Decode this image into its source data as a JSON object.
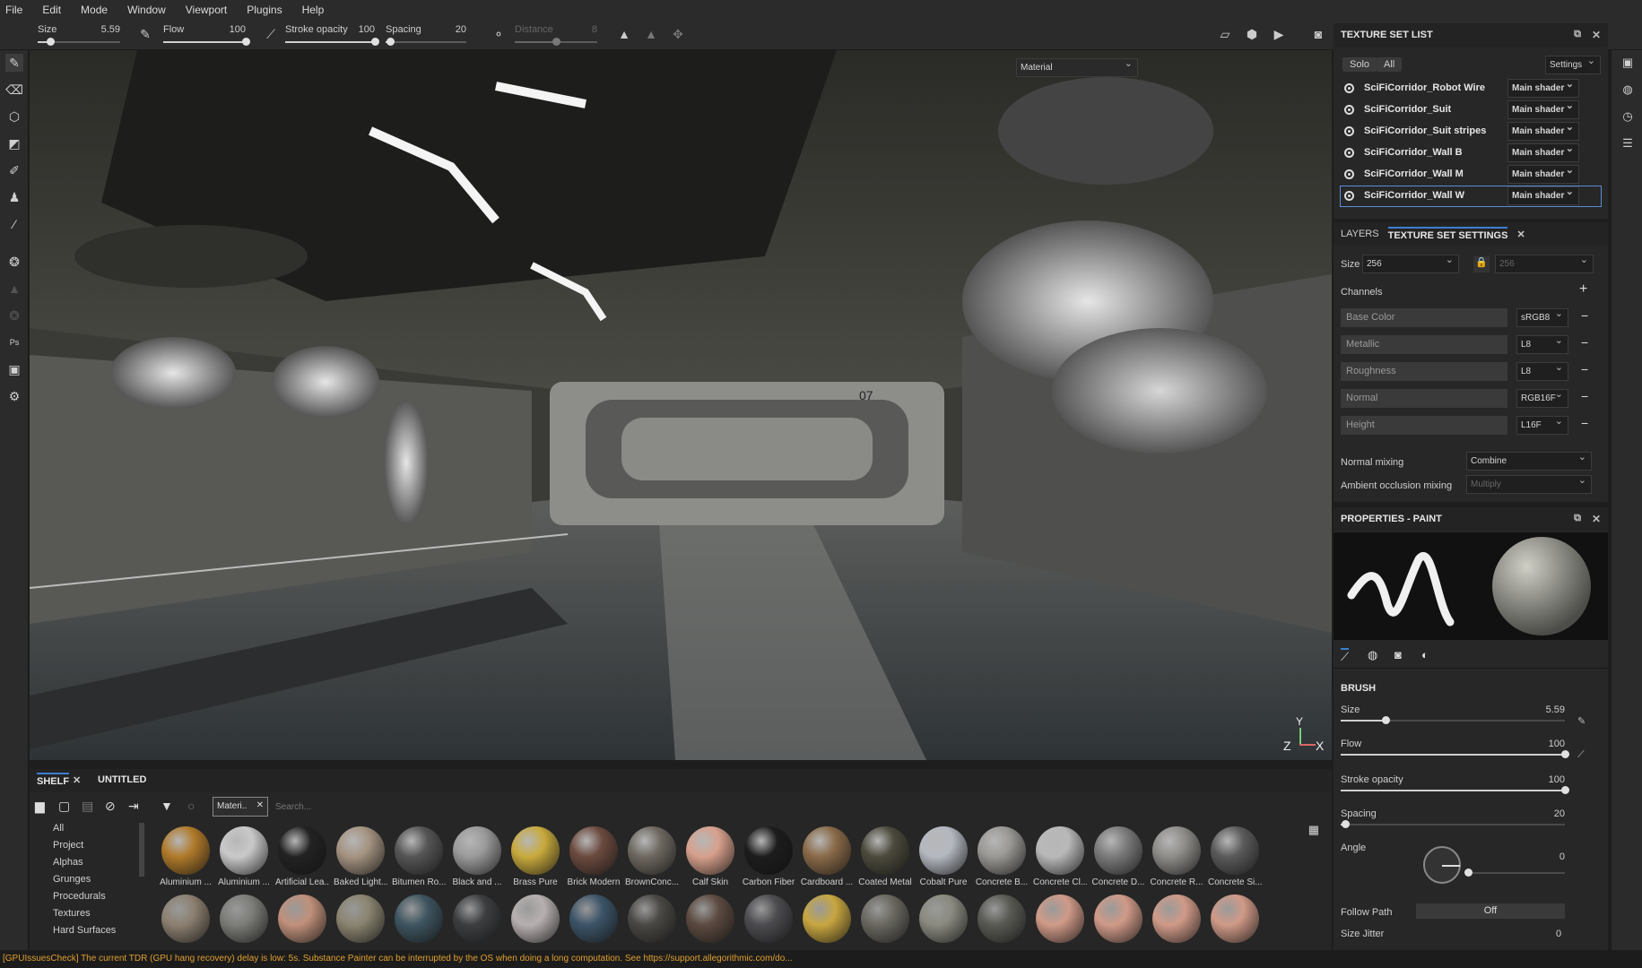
{
  "menu": [
    "File",
    "Edit",
    "Mode",
    "Window",
    "Viewport",
    "Plugins",
    "Help"
  ],
  "toolbar": {
    "size": {
      "label": "Size",
      "value": "5.59",
      "fraction": 0.15
    },
    "flow": {
      "label": "Flow",
      "value": "100",
      "fraction": 1.0
    },
    "stroke_opacity": {
      "label": "Stroke opacity",
      "value": "100",
      "fraction": 1.0
    },
    "spacing": {
      "label": "Spacing",
      "value": "20",
      "fraction": 0.05
    },
    "distance": {
      "label": "Distance",
      "value": "8",
      "fraction": 0.5
    }
  },
  "viewport": {
    "mode_dropdown": "Material",
    "axis_z": "Z",
    "axis_y": "Y",
    "axis_x": "X"
  },
  "texture_set_list": {
    "title": "TEXTURE SET LIST",
    "solo": "Solo",
    "all": "All",
    "settings": "Settings",
    "items": [
      {
        "name": "SciFiCorridor_Robot Wire",
        "shader": "Main shader"
      },
      {
        "name": "SciFiCorridor_Suit",
        "shader": "Main shader"
      },
      {
        "name": "SciFiCorridor_Suit stripes",
        "shader": "Main shader"
      },
      {
        "name": "SciFiCorridor_Wall B",
        "shader": "Main shader"
      },
      {
        "name": "SciFiCorridor_Wall M",
        "shader": "Main shader"
      },
      {
        "name": "SciFiCorridor_Wall W",
        "shader": "Main shader"
      }
    ]
  },
  "tss": {
    "tab_layers": "LAYERS",
    "tab_settings": "TEXTURE SET SETTINGS",
    "size_label": "Size",
    "size_value": "256",
    "size_value2": "256",
    "channels_label": "Channels",
    "channels": [
      {
        "name": "Base Color",
        "format": "sRGB8"
      },
      {
        "name": "Metallic",
        "format": "L8"
      },
      {
        "name": "Roughness",
        "format": "L8"
      },
      {
        "name": "Normal",
        "format": "RGB16F"
      },
      {
        "name": "Height",
        "format": "L16F"
      }
    ],
    "normal_mixing_label": "Normal mixing",
    "normal_mixing": "Combine",
    "ao_mixing_label": "Ambient occlusion mixing",
    "ao_mixing": "Multiply"
  },
  "properties": {
    "title": "PROPERTIES - PAINT",
    "brush_title": "BRUSH",
    "size": {
      "label": "Size",
      "value": "5.59",
      "fraction": 0.2
    },
    "flow": {
      "label": "Flow",
      "value": "100",
      "fraction": 1.0
    },
    "stroke_opacity": {
      "label": "Stroke opacity",
      "value": "100",
      "fraction": 1.0
    },
    "spacing": {
      "label": "Spacing",
      "value": "20",
      "fraction": 0.02
    },
    "angle": {
      "label": "Angle",
      "value": "0",
      "fraction": 0.0
    },
    "follow_path": {
      "label": "Follow Path",
      "value": "Off"
    },
    "size_jitter": {
      "label": "Size Jitter",
      "value": "0"
    }
  },
  "shelf": {
    "tab1": "SHELF",
    "tab2": "UNTITLED",
    "filter_chip": "Materi..",
    "search_placeholder": "Search...",
    "categories": [
      "All",
      "Project",
      "Alphas",
      "Grunges",
      "Procedurals",
      "Textures",
      "Hard Surfaces"
    ],
    "materials": [
      {
        "name": "Aluminium ...",
        "color": "#b07a2a"
      },
      {
        "name": "Aluminium ...",
        "color": "#c9c9c9"
      },
      {
        "name": "Artificial Lea...",
        "color": "#222222"
      },
      {
        "name": "Baked Light...",
        "color": "#a49380"
      },
      {
        "name": "Bitumen Ro...",
        "color": "#555555"
      },
      {
        "name": "Black and ...",
        "color": "#9a9a9a"
      },
      {
        "name": "Brass Pure",
        "color": "#c8aa3c"
      },
      {
        "name": "Brick Modern",
        "color": "#6b4a3e"
      },
      {
        "name": "BrownConc...",
        "color": "#6e6860"
      },
      {
        "name": "Calf Skin",
        "color": "#d7a08c"
      },
      {
        "name": "Carbon Fiber",
        "color": "#1c1c1c"
      },
      {
        "name": "Cardboard ...",
        "color": "#8a6a48"
      },
      {
        "name": "Coated Metal",
        "color": "#4c4a3c"
      },
      {
        "name": "Cobalt Pure",
        "color": "#b4b8c0"
      },
      {
        "name": "Concrete B...",
        "color": "#9a9894"
      },
      {
        "name": "Concrete Cl...",
        "color": "#b8b8b8"
      },
      {
        "name": "Concrete D...",
        "color": "#7a7a7a"
      },
      {
        "name": "Concrete R...",
        "color": "#8e8c88"
      },
      {
        "name": "Concrete Si...",
        "color": "#5a5a5a"
      }
    ],
    "row2_colors": [
      "#8c8070",
      "#7c7c78",
      "#c0907a",
      "#8a8470",
      "#3e5560",
      "#3c3e40",
      "#b8b0b0",
      "#3c5468",
      "#4a4844",
      "#5c4a40",
      "#4c4c50",
      "#c8a640",
      "#6a6860",
      "#8a8a80",
      "#5a5a54",
      "#d09a88",
      "#d09a88",
      "#d09a88",
      "#d09a88"
    ]
  },
  "status": "[GPUIssuesCheck] The current TDR (GPU hang recovery) delay is low: 5s. Substance Painter can be interrupted by the OS when doing a long computation. See https://support.allegorithmic.com/do..."
}
